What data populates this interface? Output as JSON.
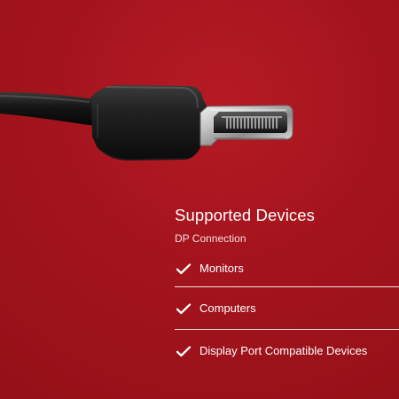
{
  "headline": "Supported Devices",
  "subheadline": "DP Connection",
  "features": [
    {
      "label": "Monitors",
      "icon": "checkmark-icon"
    },
    {
      "label": "Computers",
      "icon": "checkmark-icon"
    },
    {
      "label": "Display Port Compatible Devices",
      "icon": "checkmark-icon"
    }
  ],
  "colors": {
    "background": "#a4141d",
    "text": "#ffffff",
    "cable": "#1b1b1b"
  }
}
